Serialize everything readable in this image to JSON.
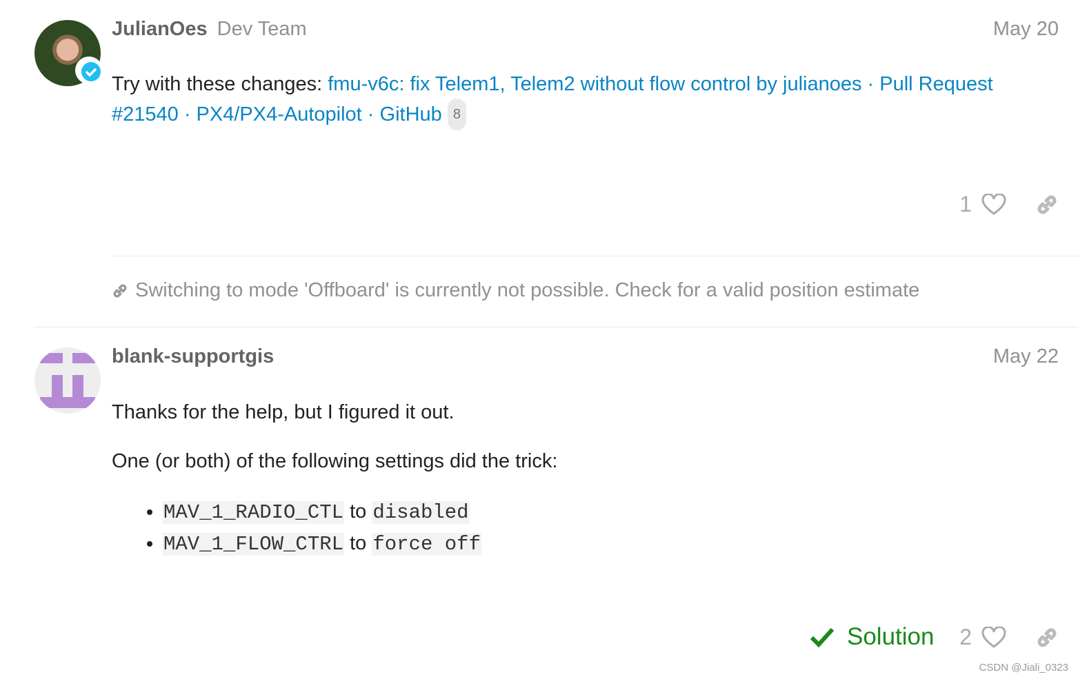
{
  "posts": [
    {
      "author": "JulianOes",
      "user_title": "Dev Team",
      "date": "May 20",
      "body_prefix": "Try with these changes: ",
      "link_text": "fmu-v6c: fix Telem1, Telem2 without flow control by julianoes · Pull Request #21540 · PX4/PX4-Autopilot · GitHub",
      "link_clicks": "8",
      "likes": "1",
      "verified_icon": "check-circle-icon"
    },
    {
      "author": "blank-supportgis",
      "date": "May 22",
      "para1": "Thanks for the help, but I figured it out.",
      "para2": "One (or both) of the following settings did the trick:",
      "items": [
        {
          "param": "MAV_1_RADIO_CTL",
          "joiner": " to ",
          "value": "disabled"
        },
        {
          "param": "MAV_1_FLOW_CTRL",
          "joiner": " to ",
          "value": "force off"
        }
      ],
      "solution_label": "Solution",
      "likes": "2"
    }
  ],
  "linked_topic": "Switching to mode 'Offboard' is currently not possible. Check for a valid position estimate",
  "watermark": "CSDN @Jiali_0323",
  "colors": {
    "link": "#0a84c5",
    "solution": "#1a8a1a",
    "avatar_purple": "#b48ad6"
  }
}
